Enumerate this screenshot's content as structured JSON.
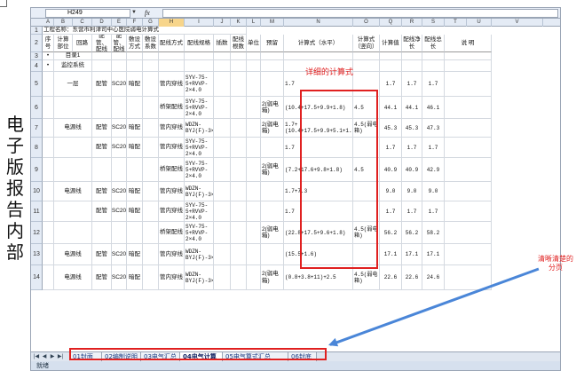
{
  "side_label": "电子版报告内部",
  "excel": {
    "name_box": "H249",
    "fx": "fx",
    "columns": [
      "A",
      "B",
      "C",
      "D",
      "E",
      "F",
      "G",
      "H",
      "I",
      "J",
      "K",
      "L",
      "M",
      "N",
      "O",
      "Q",
      "R",
      "S",
      "T",
      "U",
      "V"
    ],
    "row_numbers": [
      "1",
      "2",
      "3",
      "4",
      "5",
      "6",
      "7",
      "8",
      "9",
      "10",
      "11",
      "12",
      "13",
      "14"
    ],
    "project_title": "工程名称：东营市利津司中心医院弱电计算式",
    "headers": [
      "序号",
      "计算部位",
      "回路",
      "配管、配线",
      "配管、配线",
      "敷设方式",
      "敷设系数",
      "配线方式",
      "配线规格",
      "插数",
      "配线根数",
      "单位",
      "预留",
      "计算式（水平）",
      "计算式（竖向）",
      "计算值",
      "配线净长",
      "配线总长",
      "说 明"
    ],
    "rows": [
      {
        "num": "•",
        "part": "目录1"
      },
      {
        "num": "•",
        "part": "监控系统"
      },
      {
        "part": "一层",
        "pipe": "配管",
        "spec": "SC20",
        "lay": "暗配",
        "method": "管内穿线",
        "wire": "SYV-75-5+RVVP-2×4.0",
        "hcalc": "1.7",
        "val": "1.7",
        "net": "1.7",
        "total": "1.7"
      },
      {
        "method": "桥架配线",
        "wire": "SYV-75-5+RVVP-2×4.0",
        "reserve": "2(弱电箱)",
        "hcalc": "(10.4+17.5+9.9+1.8)",
        "vcalc": "4.5",
        "val": "44.1",
        "net": "44.1",
        "total": "46.1"
      },
      {
        "part": "电源线",
        "pipe": "配管",
        "spec": "SC20",
        "lay": "暗配",
        "method": "管内穿线",
        "wire": "WDZN-BYJ(F)-3×2.5",
        "reserve": "2(弱电箱)",
        "hcalc": "1.7+(10.4+17.5+9.9+5.1+1.6)",
        "vcalc": "4.5(弱电箱)",
        "val": "45.3",
        "net": "45.3",
        "total": "47.3"
      },
      {
        "pipe": "配管",
        "spec": "SC20",
        "lay": "暗配",
        "method": "管内穿线",
        "wire": "SYV-75-5+RVVP-2×4.0",
        "hcalc": "1.7",
        "val": "1.7",
        "net": "1.7",
        "total": "1.7"
      },
      {
        "method": "桥架配线",
        "wire": "SYV-75-5+RVVP-2×4.0",
        "reserve": "2(弱电箱)",
        "hcalc": "(7.2+17.6+9.8+1.8)",
        "vcalc": "4.5",
        "val": "40.9",
        "net": "40.9",
        "total": "42.9"
      },
      {
        "part": "电源线",
        "pipe": "配管",
        "spec": "SC20",
        "lay": "暗配",
        "method": "管内穿线",
        "wire": "WDZN-BYJ(F)-3×2.5",
        "hcalc": "1.7+7.3",
        "val": "9.0",
        "net": "9.0",
        "total": "9.0"
      },
      {
        "pipe": "配管",
        "spec": "SC20",
        "lay": "暗配",
        "method": "管内穿线",
        "wire": "SYV-75-5+RVVP-2×4.0",
        "hcalc": "1.7",
        "val": "1.7",
        "net": "1.7",
        "total": "1.7"
      },
      {
        "method": "桥架配线",
        "wire": "SYV-75-5+RVVP-2×4.0",
        "reserve": "2(弱电箱)",
        "hcalc": "(22.8+17.5+9.6+1.8)",
        "vcalc": "4.5(弱电箱)",
        "val": "56.2",
        "net": "56.2",
        "total": "58.2"
      },
      {
        "part": "电源线",
        "pipe": "配管",
        "spec": "SC20",
        "lay": "暗配",
        "method": "管内穿线",
        "wire": "WDZN-BYJ(F)-3×2.5",
        "hcalc": "(15.5+1.6)",
        "val": "17.1",
        "net": "17.1",
        "total": "17.1"
      },
      {
        "part": "电源线",
        "pipe": "配管",
        "spec": "SC20",
        "lay": "暗配",
        "method": "管内穿线",
        "wire": "WDZN-BYJ(F)-3×2.5",
        "reserve": "2(弱电箱)",
        "hcalc": "(0.8+3.8+11)+2.5",
        "vcalc": "4.5(弱电箱)",
        "val": "22.6",
        "net": "22.6",
        "total": "24.6"
      }
    ],
    "annotation_detail": "详细的计算式",
    "annotation_pages": "清晰清楚的分页",
    "sheet_tabs": [
      "01封面",
      "02编制说明",
      "03电气汇总",
      "04电气计算",
      "05电气算式汇总",
      "06封底"
    ],
    "active_tab": "04电气计算",
    "status": "就绪"
  },
  "colors": {
    "accent_red": "#e02020",
    "arrow_blue": "#4a86d8",
    "header_bg": "#e4ebf5"
  }
}
